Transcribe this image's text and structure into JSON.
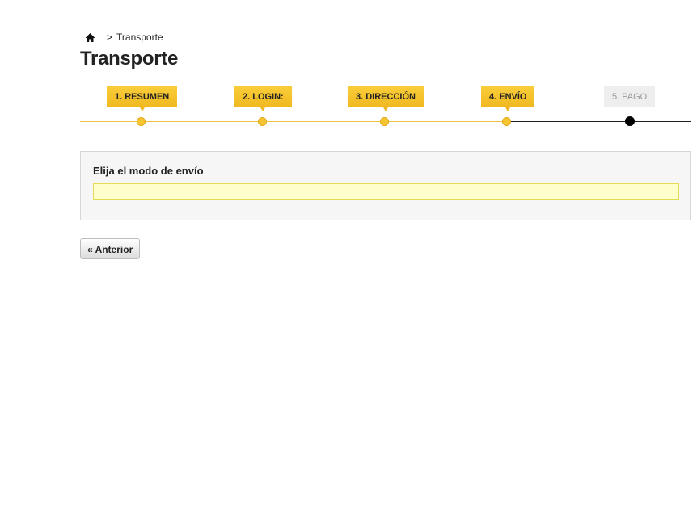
{
  "breadcrumb": {
    "home_icon": "home-icon",
    "separator": ">",
    "current": "Transporte"
  },
  "page_title": "Transporte",
  "steps": [
    {
      "label": "1. RESUMEN",
      "state": "done"
    },
    {
      "label": "2. LOGIN:",
      "state": "done"
    },
    {
      "label": "3. DIRECCIÓN",
      "state": "done"
    },
    {
      "label": "4. ENVÍO",
      "state": "current"
    },
    {
      "label": "5. PAGO",
      "state": "pending"
    }
  ],
  "shipping": {
    "title": "Elija el modo de envío"
  },
  "back_button": {
    "label": "« Anterior"
  },
  "colors": {
    "accent": "#f7c531",
    "warning_bg": "#ffffcc"
  }
}
